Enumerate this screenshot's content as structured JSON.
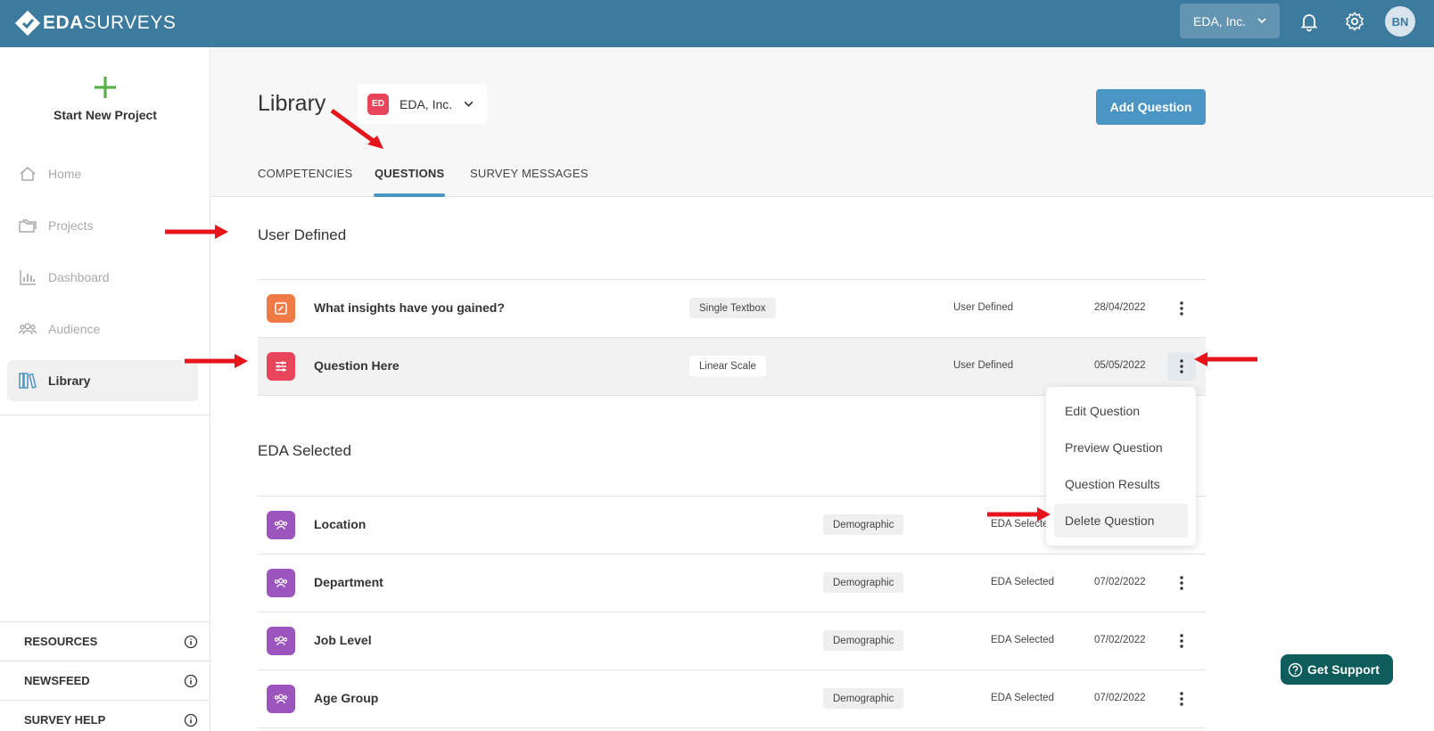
{
  "header": {
    "logo_bold": "EDA",
    "logo_light": "SURVEYS",
    "org_select": "EDA, Inc.",
    "avatar_initials": "BN"
  },
  "sidebar": {
    "start_new": "Start New Project",
    "items": [
      {
        "label": "Home",
        "icon": "home-icon"
      },
      {
        "label": "Projects",
        "icon": "folders-icon"
      },
      {
        "label": "Dashboard",
        "icon": "bar-chart-icon"
      },
      {
        "label": "Audience",
        "icon": "people-icon"
      },
      {
        "label": "Library",
        "icon": "books-icon",
        "active": true
      }
    ],
    "footer": [
      "RESOURCES",
      "NEWSFEED",
      "SURVEY HELP"
    ]
  },
  "library": {
    "title": "Library",
    "org_badge": "ED",
    "org_name": "EDA, Inc.",
    "add_button": "Add Question",
    "tabs": [
      "COMPETENCIES",
      "QUESTIONS",
      "SURVEY MESSAGES"
    ],
    "active_tab": "QUESTIONS"
  },
  "user_defined": {
    "title": "User Defined",
    "rows": [
      {
        "title": "What insights have you gained?",
        "type": "Single Textbox",
        "source": "User Defined",
        "date": "28/04/2022",
        "icon": "edit-icon",
        "color": "#ee7a45"
      },
      {
        "title": "Question Here",
        "type": "Linear Scale",
        "source": "User Defined",
        "date": "05/05/2022",
        "icon": "sliders-icon",
        "color": "#e9455a"
      }
    ]
  },
  "context_menu": {
    "items": [
      "Edit Question",
      "Preview Question",
      "Question Results",
      "Delete Question"
    ],
    "hovered": "Delete Question"
  },
  "eda_selected": {
    "title": "EDA Selected",
    "rows": [
      {
        "title": "Location",
        "type": "Demographic",
        "source": "EDA Selecte",
        "date": "",
        "icon": "people-icon",
        "color": "#9c55bd"
      },
      {
        "title": "Department",
        "type": "Demographic",
        "source": "EDA Selected",
        "date": "07/02/2022",
        "icon": "people-icon",
        "color": "#9c55bd"
      },
      {
        "title": "Job Level",
        "type": "Demographic",
        "source": "EDA Selected",
        "date": "07/02/2022",
        "icon": "people-icon",
        "color": "#9c55bd"
      },
      {
        "title": "Age Group",
        "type": "Demographic",
        "source": "EDA Selected",
        "date": "07/02/2022",
        "icon": "people-icon",
        "color": "#9c55bd"
      }
    ]
  },
  "support": {
    "label": "Get Support"
  },
  "colors": {
    "topbar": "#3c7a9e",
    "accent": "#4a95c4",
    "annotation": "#e8141c"
  }
}
